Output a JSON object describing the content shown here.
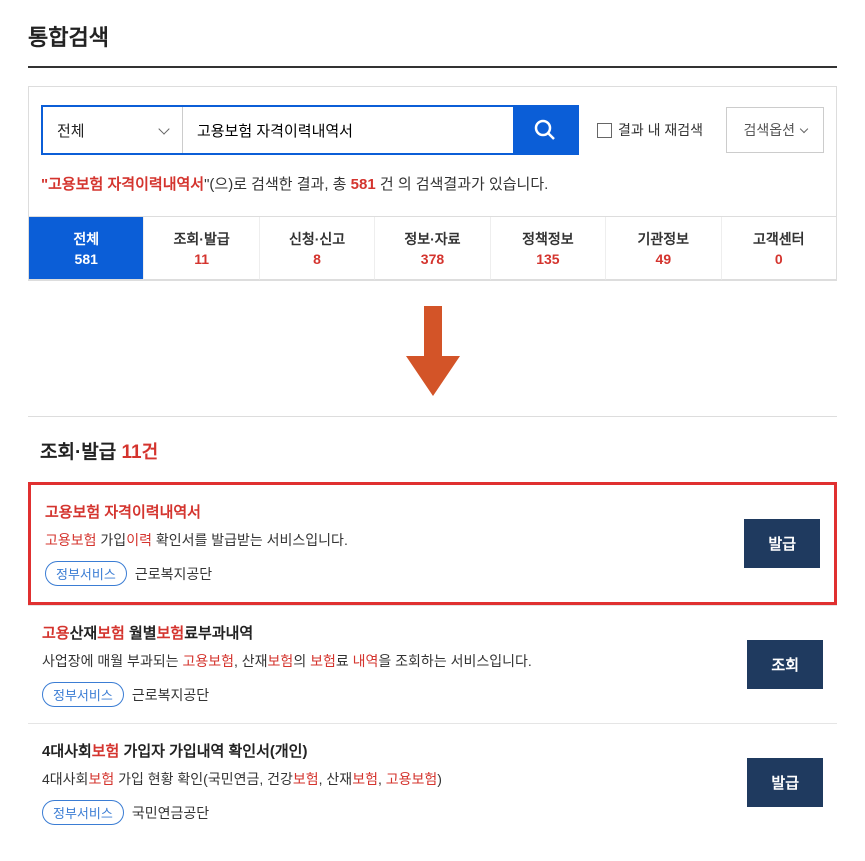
{
  "page_title": "통합검색",
  "search": {
    "category": "전체",
    "input_value": "고용보험 자격이력내역서",
    "re_search_label": "결과 내 재검색",
    "options_label": "검색옵션"
  },
  "result_summary": {
    "prefix": "\"",
    "query": "고용보험 자격이력내역서",
    "mid": "\"(으)로 검색한 결과, 총 ",
    "count": "581",
    "suffix": " 건 의 검색결과가 있습니다."
  },
  "tabs": {
    "t0": {
      "label": "전체",
      "count": "581"
    },
    "t1": {
      "label": "조회·발급",
      "count": "11"
    },
    "t2": {
      "label": "신청·신고",
      "count": "8"
    },
    "t3": {
      "label": "정보·자료",
      "count": "378"
    },
    "t4": {
      "label": "정책정보",
      "count": "135"
    },
    "t5": {
      "label": "기관정보",
      "count": "49"
    },
    "t6": {
      "label": "고객센터",
      "count": "0"
    }
  },
  "section": {
    "title": "조회·발급 ",
    "count": "11",
    "unit": "건"
  },
  "items": {
    "i0": {
      "title_hl": "고용보험 자격이력내역서",
      "desc_p1": "고용보험",
      "desc_p2": " 가입",
      "desc_p3": "이력",
      "desc_p4": " 확인서를 발급받는 서비스입니다.",
      "badge": "정부서비스",
      "org": "근로복지공단",
      "action": "발급"
    },
    "i1": {
      "t1": "고용",
      "t2": "산재",
      "t3": "보험",
      "t4": " 월별",
      "t5": "보험",
      "t6": "료부과내역",
      "d1": "사업장에 매월 부과되는 ",
      "d2": "고용보험",
      "d3": ", 산재",
      "d4": "보험",
      "d5": "의 ",
      "d6": "보험",
      "d7": "료 ",
      "d8": "내역",
      "d9": "을 조회하는 서비스입니다.",
      "badge": "정부서비스",
      "org": "근로복지공단",
      "action": "조회"
    },
    "i2": {
      "t1": "4대사회",
      "t2": "보험",
      "t3": " 가입자 가입내역 확인서(개인)",
      "d1": "4대사회",
      "d2": "보험",
      "d3": " 가입 현황 확인(국민연금, 건강",
      "d4": "보험",
      "d5": ", 산재",
      "d6": "보험",
      "d7": ", ",
      "d8": "고용보험",
      "d9": ")",
      "badge": "정부서비스",
      "org": "국민연금공단",
      "action": "발급"
    }
  }
}
